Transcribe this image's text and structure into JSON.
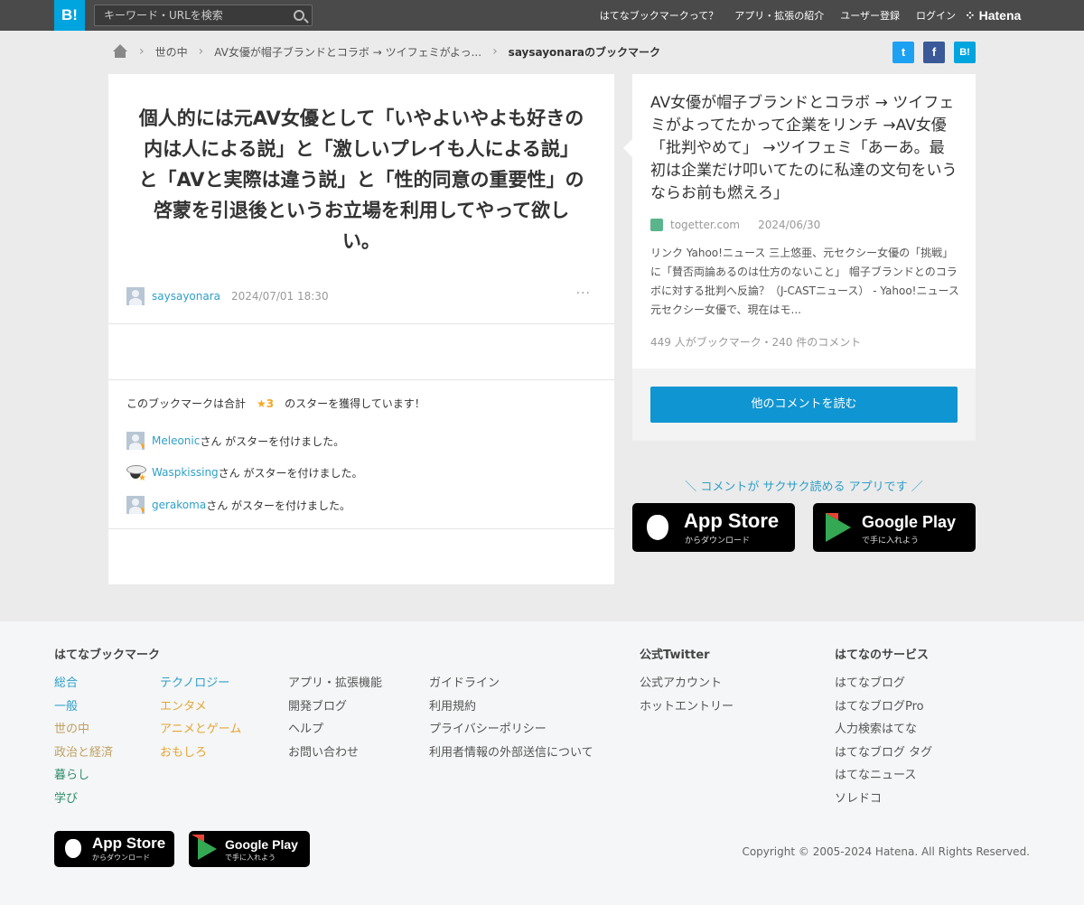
{
  "header": {
    "logo": "B!",
    "search_placeholder": "キーワード・URLを検索",
    "nav": [
      "はてなブックマークって？",
      "アプリ・拡張の紹介",
      "ユーザー登録",
      "ログイン"
    ],
    "brand": "Hatena"
  },
  "breadcrumb": {
    "items": [
      "世の中",
      "AV女優が帽子ブランドとコラボ → ツイフェミがよっ..."
    ],
    "current": "saysayonaraのブックマーク"
  },
  "share": {
    "twitter": "t",
    "facebook": "f",
    "hatena": "B!"
  },
  "comment": {
    "text": "個人的には元AV女優として「いやよいやよも好きの内は人による説」と「激しいプレイも人による説」と「AVと実際は違う説」と「性的同意の重要性」の啓蒙を引退後というお立場を利用してやって欲しい。",
    "user": "saysayonara",
    "date": "2024/07/01 18:30",
    "more": "···"
  },
  "stars": {
    "summary_prefix": "このブックマークは合計",
    "count": "★3",
    "summary_suffix": "のスターを獲得しています！",
    "rows": [
      {
        "user": "Meleonic",
        "suffix": "さん がスターを付けました。"
      },
      {
        "user": "Waspkissing",
        "suffix": "さん がスターを付けました。"
      },
      {
        "user": "gerakoma",
        "suffix": "さん がスターを付けました。"
      }
    ]
  },
  "entry": {
    "title": "AV女優が帽子ブランドとコラボ → ツイフェミがよってたかって企業をリンチ →AV女優「批判やめて」 →ツイフェミ「あーあ。最初は企業だけ叩いてたのに私達の文句をいうならお前も燃えろ」",
    "source": "togetter.com",
    "date": "2024/06/30",
    "description": "リンク Yahoo!ニュース 三上悠亜、元セクシー女優の「挑戦」に「賛否両論あるのは仕方のないこと」 帽子ブランドとのコラボに対する批判へ反論？（J-CASTニュース） - Yahoo!ニュース 元セクシー女優で、現在はモ...",
    "counts": "449 人がブックマーク・240 件のコメント",
    "read_more": "他のコメントを読む"
  },
  "app": {
    "promo": "＼ コメントが サクサク読める アプリです ／",
    "appstore_main": "App Store",
    "appstore_sub": "からダウンロード",
    "googleplay_main": "Google Play",
    "googleplay_sub": "で手に入れよう"
  },
  "footer": {
    "heading_bookmark": "はてなブックマーク",
    "heading_twitter": "公式Twitter",
    "heading_services": "はてなのサービス",
    "col1": [
      "総合",
      "一般",
      "世の中",
      "政治と経済",
      "暮らし",
      "学び"
    ],
    "col2": [
      "テクノロジー",
      "エンタメ",
      "アニメとゲーム",
      "おもしろ"
    ],
    "col3": [
      "アプリ・拡張機能",
      "開発ブログ",
      "ヘルプ",
      "お問い合わせ"
    ],
    "col4": [
      "ガイドライン",
      "利用規約",
      "プライバシーポリシー",
      "利用者情報の外部送信について"
    ],
    "twitter_links": [
      "公式アカウント",
      "ホットエントリー"
    ],
    "services": [
      "はてなブログ",
      "はてなブログPro",
      "人力検索はてな",
      "はてなブログ タグ",
      "はてなニュース",
      "ソレドコ"
    ],
    "copyright": "Copyright © 2005-2024 Hatena. All Rights Reserved."
  },
  "colors": {
    "accent": "#00a4de",
    "link": "#2e9fc8",
    "star": "#f5a623",
    "button": "#0f95d1",
    "col1": [
      "#2e9fc8",
      "#2e9fc8",
      "#c0a060",
      "#c0a060",
      "#2e8c6a",
      "#2e8c6a"
    ],
    "col2": "#e6a531"
  }
}
